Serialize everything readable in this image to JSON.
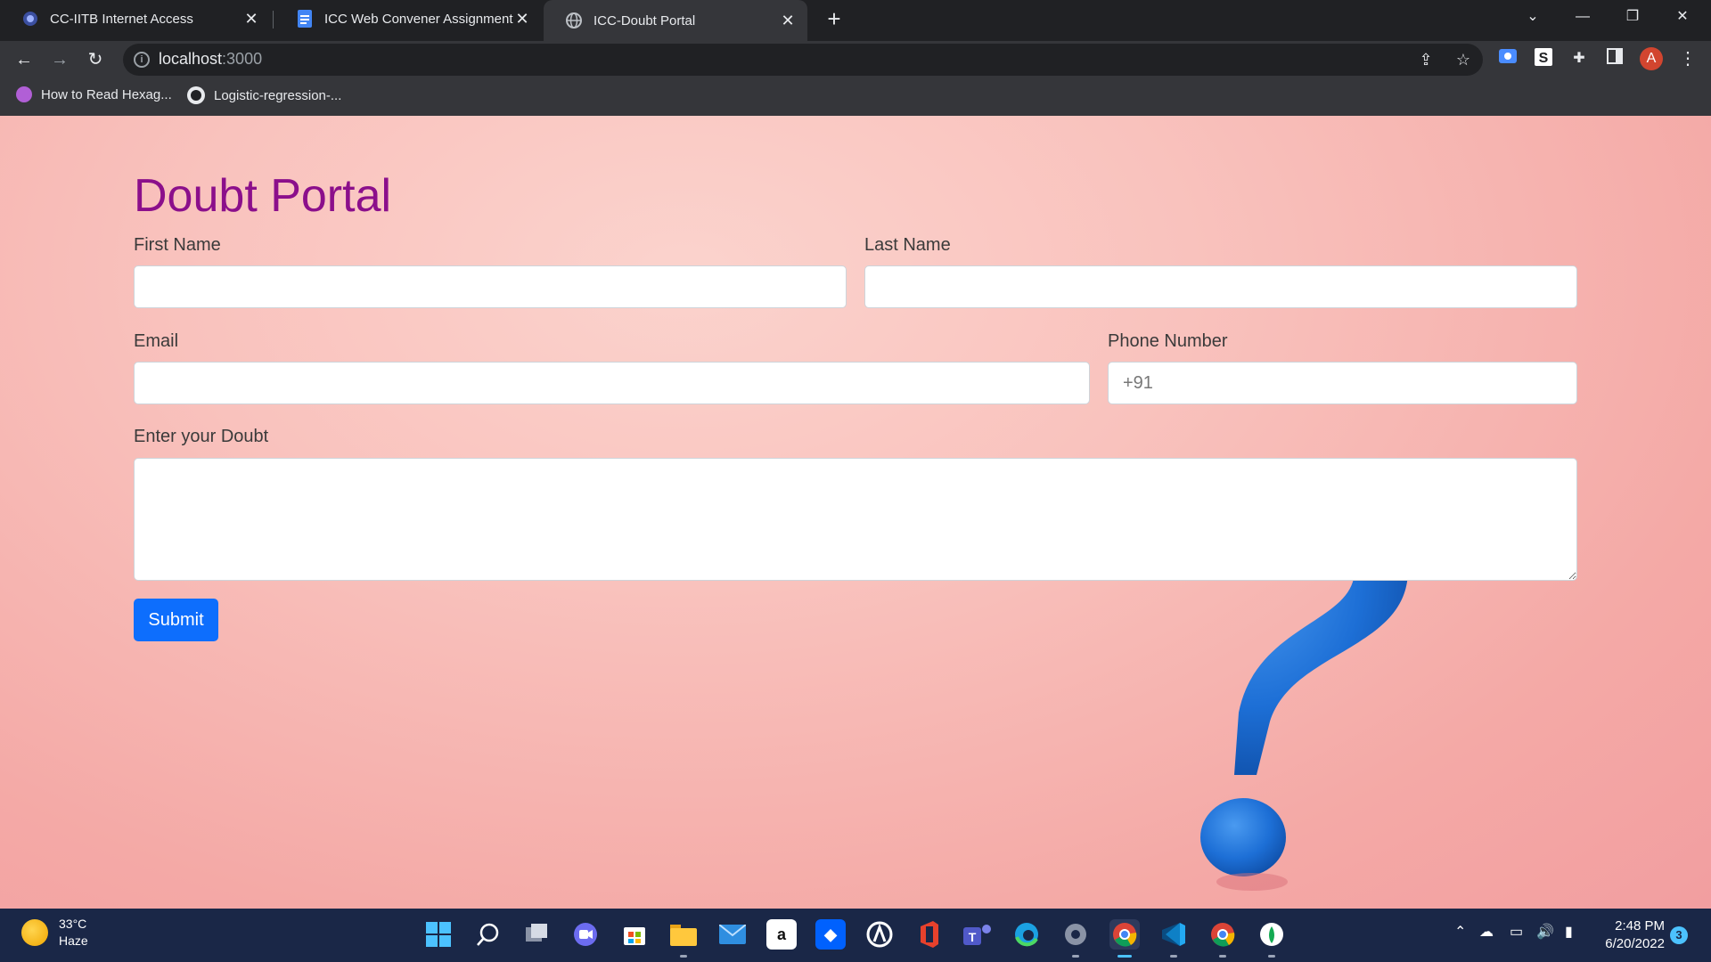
{
  "browser": {
    "tabs": [
      {
        "label": "CC-IITB Internet Access",
        "icon": "iitb-logo-icon"
      },
      {
        "label": "ICC Web Convener Assignment -",
        "icon": "google-docs-icon"
      },
      {
        "label": "ICC-Doubt Portal",
        "icon": "globe-icon"
      }
    ],
    "url_host": "localhost",
    "url_port": ":3000",
    "profile_initial": "A",
    "bookmarks": [
      {
        "label": "How to Read Hexag..."
      },
      {
        "label": "Logistic-regression-..."
      }
    ]
  },
  "page": {
    "title": "Doubt Portal",
    "first_name_label": "First Name",
    "last_name_label": "Last Name",
    "email_label": "Email",
    "phone_label": "Phone Number",
    "phone_placeholder": "+91",
    "doubt_label": "Enter your Doubt",
    "submit_label": "Submit"
  },
  "taskbar": {
    "temperature": "33°C",
    "weather": "Haze",
    "time": "2:48 PM",
    "date": "6/20/2022",
    "notifications": "3"
  },
  "colors": {
    "heading": "#8b0f8b",
    "button": "#0d6efd",
    "page_bg": "#f9c2bd"
  }
}
